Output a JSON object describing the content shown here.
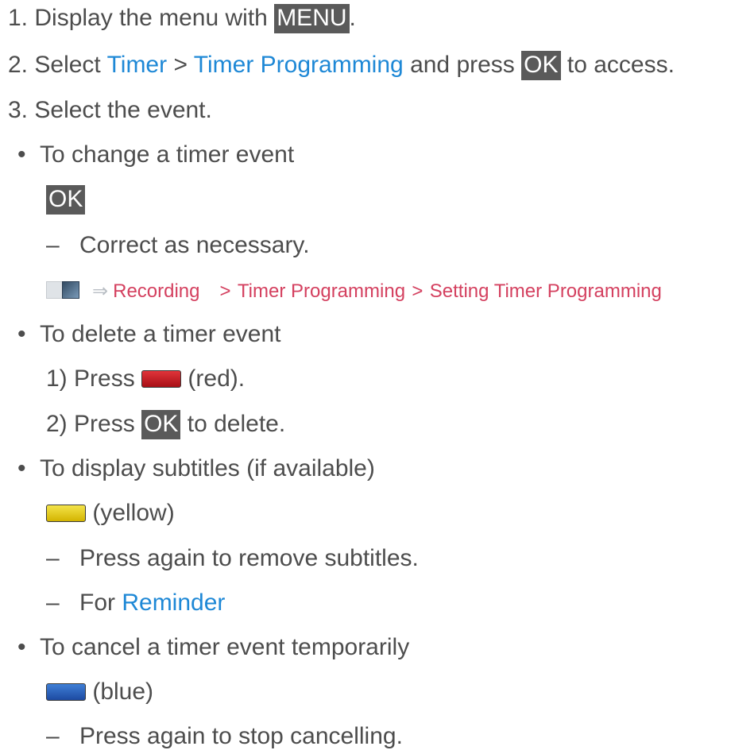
{
  "steps": {
    "s1": {
      "num": "1.",
      "text": "Display the menu with",
      "key": "MENU",
      "end": "."
    },
    "s2": {
      "num": "2.",
      "text_a": "Select",
      "link_a": "Timer",
      "sep": ">",
      "link_b": "Timer Programming",
      "text_b": "and press",
      "key": "OK",
      "text_c": "to access."
    },
    "s3": {
      "num": "3.",
      "text": "Select the event."
    }
  },
  "change": {
    "bullet": "•",
    "title": "To change a timer event",
    "key": "OK",
    "dash": "–",
    "note": "Correct as necessary.",
    "ref": {
      "part1": "Recording",
      "sep1": ">",
      "part2": "Timer Programming",
      "sep2": ">",
      "part3": "Setting Timer Programming"
    }
  },
  "delete": {
    "bullet": "•",
    "title": "To delete a timer event",
    "step1": {
      "num": "1)",
      "text": "Press",
      "color": "(red)."
    },
    "step2": {
      "num": "2)",
      "text_a": "Press",
      "key": "OK",
      "text_b": "to delete."
    }
  },
  "subtitles": {
    "bullet": "•",
    "title": "To display subtitles (if available)",
    "color": "(yellow)",
    "dash1": "–",
    "note1": "Press again to remove subtitles.",
    "dash2": "–",
    "note2_text": "For",
    "note2_link": "Reminder"
  },
  "cancel": {
    "bullet": "•",
    "title": "To cancel a timer event temporarily",
    "color": "(blue)",
    "dash": "–",
    "note": "Press again to stop cancelling."
  },
  "icons": {
    "book": "ebook-icon",
    "arrow": "arrow-right-icon",
    "red": "red-button-icon",
    "yellow": "yellow-button-icon",
    "blue": "blue-button-icon"
  },
  "colors": {
    "text": "#4d4d4d",
    "link": "#1e88d6",
    "reference": "#d4405f",
    "key_bg": "#5a5a5a",
    "red": "#c8161e",
    "yellow": "#e8d000",
    "blue": "#2a5fbf"
  }
}
